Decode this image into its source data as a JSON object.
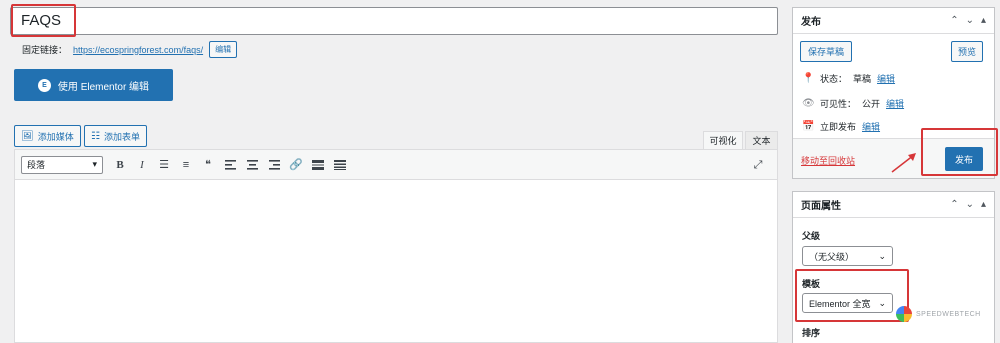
{
  "title": {
    "value": "FAQS"
  },
  "permalink": {
    "label": "固定链接：",
    "url": "https://ecospringforest.com/faqs/",
    "edit_label": "编辑"
  },
  "elementor": {
    "icon_text": "E",
    "label": "使用 Elementor 编辑"
  },
  "media": {
    "add_media": "添加媒体",
    "add_form": "添加表单"
  },
  "editor_tabs": {
    "visual": "可视化",
    "text": "文本"
  },
  "toolbar": {
    "format_value": "段落",
    "bold": "B",
    "italic": "I"
  },
  "publish_box": {
    "title": "发布",
    "save_draft": "保存草稿",
    "preview": "预览",
    "status_label": "状态：",
    "status_value": "草稿",
    "status_edit": "编辑",
    "visibility_label": "可见性：",
    "visibility_value": "公开",
    "visibility_edit": "编辑",
    "schedule_label": "立即发布",
    "schedule_edit": "编辑",
    "trash": "移动至回收站",
    "publish": "发布"
  },
  "page_attributes": {
    "title": "页面属性",
    "parent_label": "父级",
    "parent_value": "（无父级）",
    "template_label": "模板",
    "template_value": "Elementor 全宽",
    "order_label": "排序"
  },
  "watermark": {
    "text": "SPEEDWEBTECH"
  },
  "colors": {
    "primary": "#2271b1",
    "highlight": "#d63638",
    "background": "#f0f0f1"
  }
}
